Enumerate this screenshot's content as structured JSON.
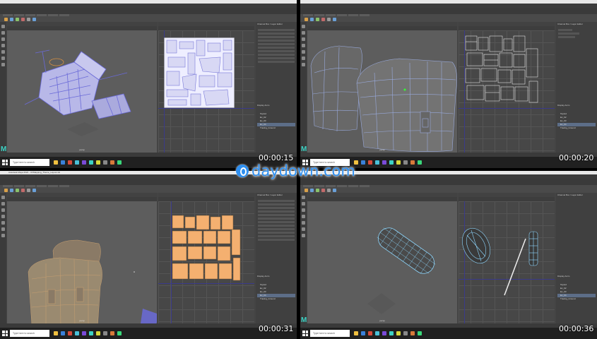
{
  "screenshot": {
    "description": "Four-panel collage of Maya UV mapping tutorial frames",
    "panels": [
      {
        "id": "top-left",
        "timestamp": "00:00:15",
        "viewport_label": "persp",
        "right_panel_title": "Channel Box / Layer Editor",
        "layer_tabs": "Display  Anim",
        "layers": [
          "TopLid",
          "Ex_02",
          "Ex_03",
          "Ex_04",
          "Tracing_Ground"
        ]
      },
      {
        "id": "top-right",
        "timestamp": "00:00:20",
        "viewport_label": "persp",
        "right_panel_title": "Channel Box / Layer Editor",
        "layer_tabs": "Display  Anim",
        "layers": [
          "TopLid",
          "Ex_02",
          "Ex_03",
          "Ex_04",
          "Tracing_Ground"
        ]
      },
      {
        "id": "bottom-left",
        "timestamp": "00:00:31",
        "viewport_label": "persp",
        "window_title": "Autodesk Maya 2022 - UVMapping_Theme_Layout.mb",
        "right_panel_title": "Channel Box / Layer Editor",
        "layer_tabs": "Display  Anim",
        "layers": [
          "TopLid",
          "Ex_02",
          "Ex_03",
          "Ex_04",
          "Tracing_Ground"
        ]
      },
      {
        "id": "bottom-right",
        "timestamp": "00:00:36",
        "viewport_label": "persp",
        "right_panel_title": "Channel Box / Layer Editor",
        "layer_tabs": "Display  Anim",
        "layers": [
          "TopLid",
          "Ex_02",
          "Ex_03",
          "Ex_04",
          "Tracing_Ground"
        ]
      }
    ],
    "taskbar": {
      "search_placeholder": "Type here to search"
    },
    "watermark": {
      "text": "daydown.com"
    },
    "app": {
      "logo_letter": "M",
      "accent_color": "#3dd3c5"
    },
    "colors": {
      "wireframe_blue": "#6a6ad8",
      "uv_shell_orange": "#f4b070",
      "selection_highlight": "#5d6e88",
      "viewport_bg": "#5d5d5d",
      "uv_bg": "#474747"
    }
  }
}
